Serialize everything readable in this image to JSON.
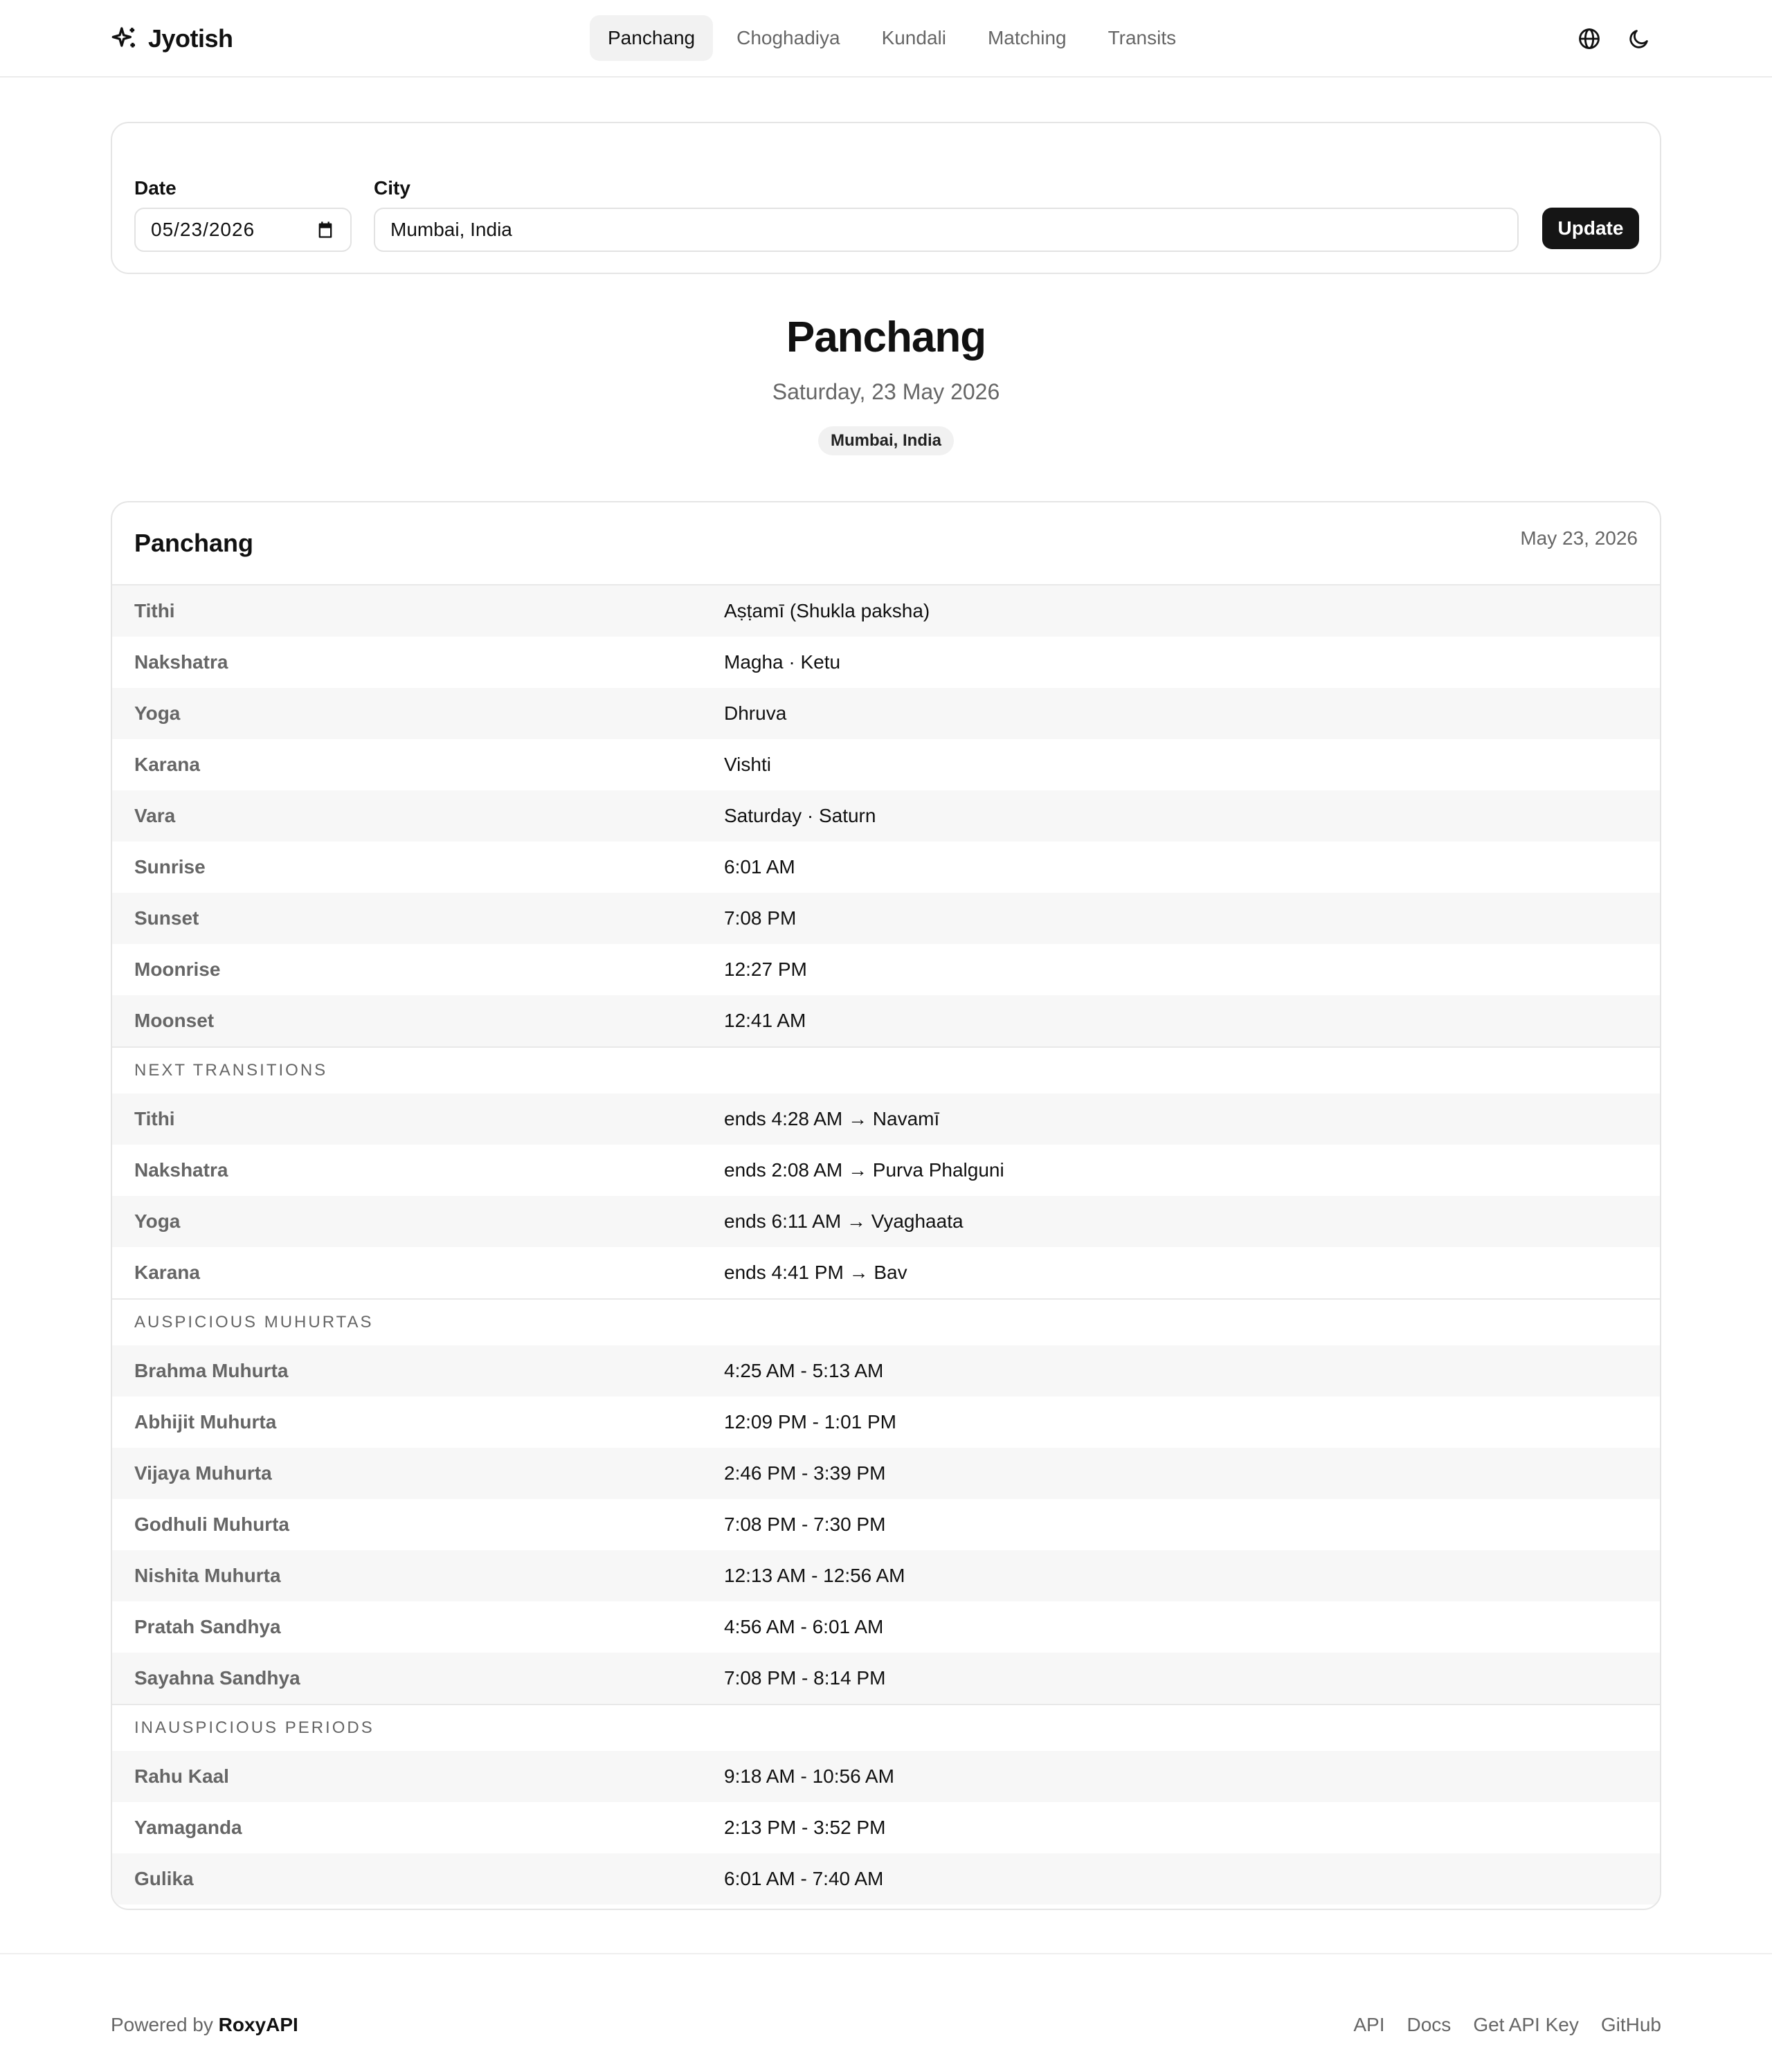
{
  "brand": {
    "name": "Jyotish"
  },
  "nav": {
    "tabs": [
      {
        "label": "Panchang",
        "active": true
      },
      {
        "label": "Choghadiya"
      },
      {
        "label": "Kundali"
      },
      {
        "label": "Matching"
      },
      {
        "label": "Transits"
      }
    ]
  },
  "header_icons": [
    "globe-icon",
    "moon-icon"
  ],
  "form": {
    "date_label": "Date",
    "date_value": "05/23/2026",
    "city_label": "City",
    "city_value": "Mumbai, India",
    "update_label": "Update"
  },
  "heading": {
    "title": "Panchang",
    "date": "Saturday, 23 May 2026",
    "location": "Mumbai, India"
  },
  "card": {
    "title": "Panchang",
    "date": "May 23, 2026",
    "rows": [
      {
        "key": "Tithi",
        "value": "Aṣṭamī (Shukla paksha)"
      },
      {
        "key": "Nakshatra",
        "value": "Magha · Ketu"
      },
      {
        "key": "Yoga",
        "value": "Dhruva"
      },
      {
        "key": "Karana",
        "value": "Vishti"
      },
      {
        "key": "Vara",
        "value": "Saturday · Saturn"
      },
      {
        "key": "Sunrise",
        "value": "6:01 AM"
      },
      {
        "key": "Sunset",
        "value": "7:08 PM"
      },
      {
        "key": "Moonrise",
        "value": "12:27 PM"
      },
      {
        "key": "Moonset",
        "value": "12:41 AM"
      }
    ],
    "transitions_title": "Next Transitions",
    "transitions": [
      {
        "key": "Tithi",
        "value": "ends 4:28 AM → Navamī"
      },
      {
        "key": "Nakshatra",
        "value": "ends 2:08 AM → Purva Phalguni"
      },
      {
        "key": "Yoga",
        "value": "ends 6:11 AM → Vyaghaata"
      },
      {
        "key": "Karana",
        "value": "ends 4:41 PM → Bav"
      }
    ],
    "auspicious_title": "Auspicious Muhurtas",
    "auspicious": [
      {
        "key": "Brahma Muhurta",
        "value": "4:25 AM - 5:13 AM"
      },
      {
        "key": "Abhijit Muhurta",
        "value": "12:09 PM - 1:01 PM"
      },
      {
        "key": "Vijaya Muhurta",
        "value": "2:46 PM - 3:39 PM"
      },
      {
        "key": "Godhuli Muhurta",
        "value": "7:08 PM - 7:30 PM"
      },
      {
        "key": "Nishita Muhurta",
        "value": "12:13 AM - 12:56 AM"
      },
      {
        "key": "Pratah Sandhya",
        "value": "4:56 AM - 6:01 AM"
      },
      {
        "key": "Sayahna Sandhya",
        "value": "7:08 PM - 8:14 PM"
      }
    ],
    "inauspicious_title": "Inauspicious Periods",
    "inauspicious": [
      {
        "key": "Rahu Kaal",
        "value": "9:18 AM - 10:56 AM"
      },
      {
        "key": "Yamaganda",
        "value": "2:13 PM - 3:52 PM"
      },
      {
        "key": "Gulika",
        "value": "6:01 AM - 7:40 AM"
      }
    ]
  },
  "footer": {
    "powered_prefix": "Powered by",
    "powered_brand": "RoxyAPI",
    "links": [
      "API",
      "Docs",
      "Get API Key",
      "GitHub"
    ]
  }
}
